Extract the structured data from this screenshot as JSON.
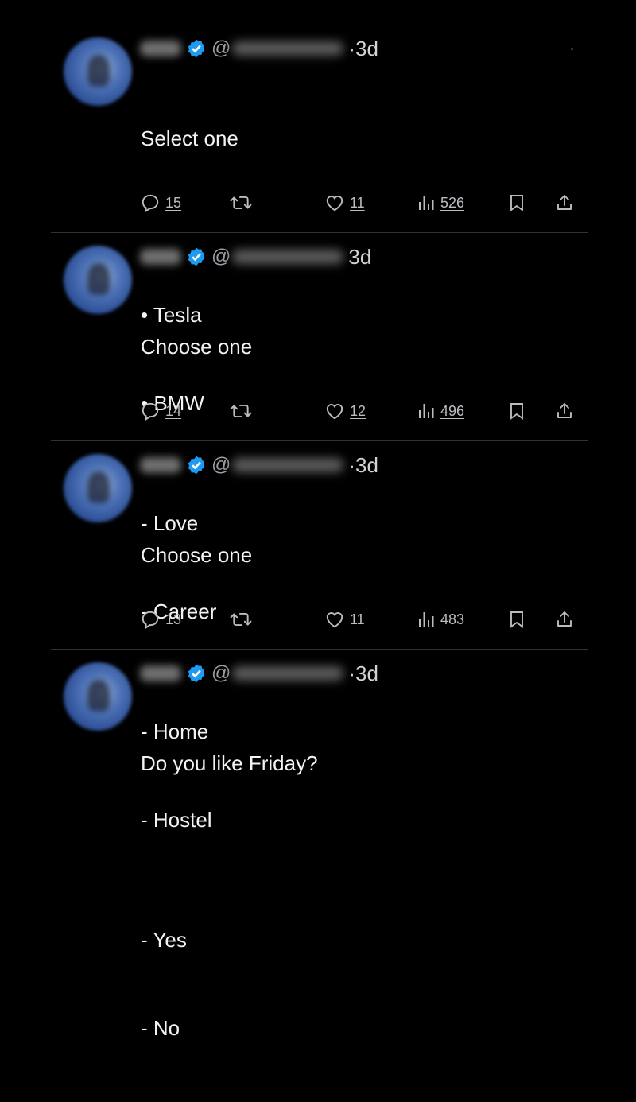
{
  "tweets": [
    {
      "time": "3d",
      "lines": [
        "Select one",
        "",
        "• Tesla",
        "• BMW"
      ],
      "replies": "15",
      "likes": "11",
      "views": "526"
    },
    {
      "time": "3d",
      "lines": [
        "Choose one",
        "",
        "- Love",
        "- Career"
      ],
      "replies": "14",
      "likes": "12",
      "views": "496"
    },
    {
      "time": "3d",
      "lines": [
        "Choose one",
        "",
        "- Home",
        "- Hostel"
      ],
      "replies": "13",
      "likes": "11",
      "views": "483"
    },
    {
      "time": "3d",
      "lines": [
        "Do you like Friday?",
        "",
        "- Yes",
        "- No"
      ],
      "replies": "",
      "likes": "",
      "views": ""
    }
  ],
  "handle_prefix": "@",
  "time_separator": "·",
  "icons": {
    "reply": "reply-icon",
    "retweet": "retweet-icon",
    "like": "like-icon",
    "views": "views-icon",
    "bookmark": "bookmark-icon",
    "share": "share-icon",
    "verified": "verified-badge-icon"
  },
  "colors": {
    "background": "#000000",
    "text": "#e7e9ea",
    "muted": "#b9bcc0",
    "verified": "#1d9bf0",
    "divider": "#2f3336"
  }
}
